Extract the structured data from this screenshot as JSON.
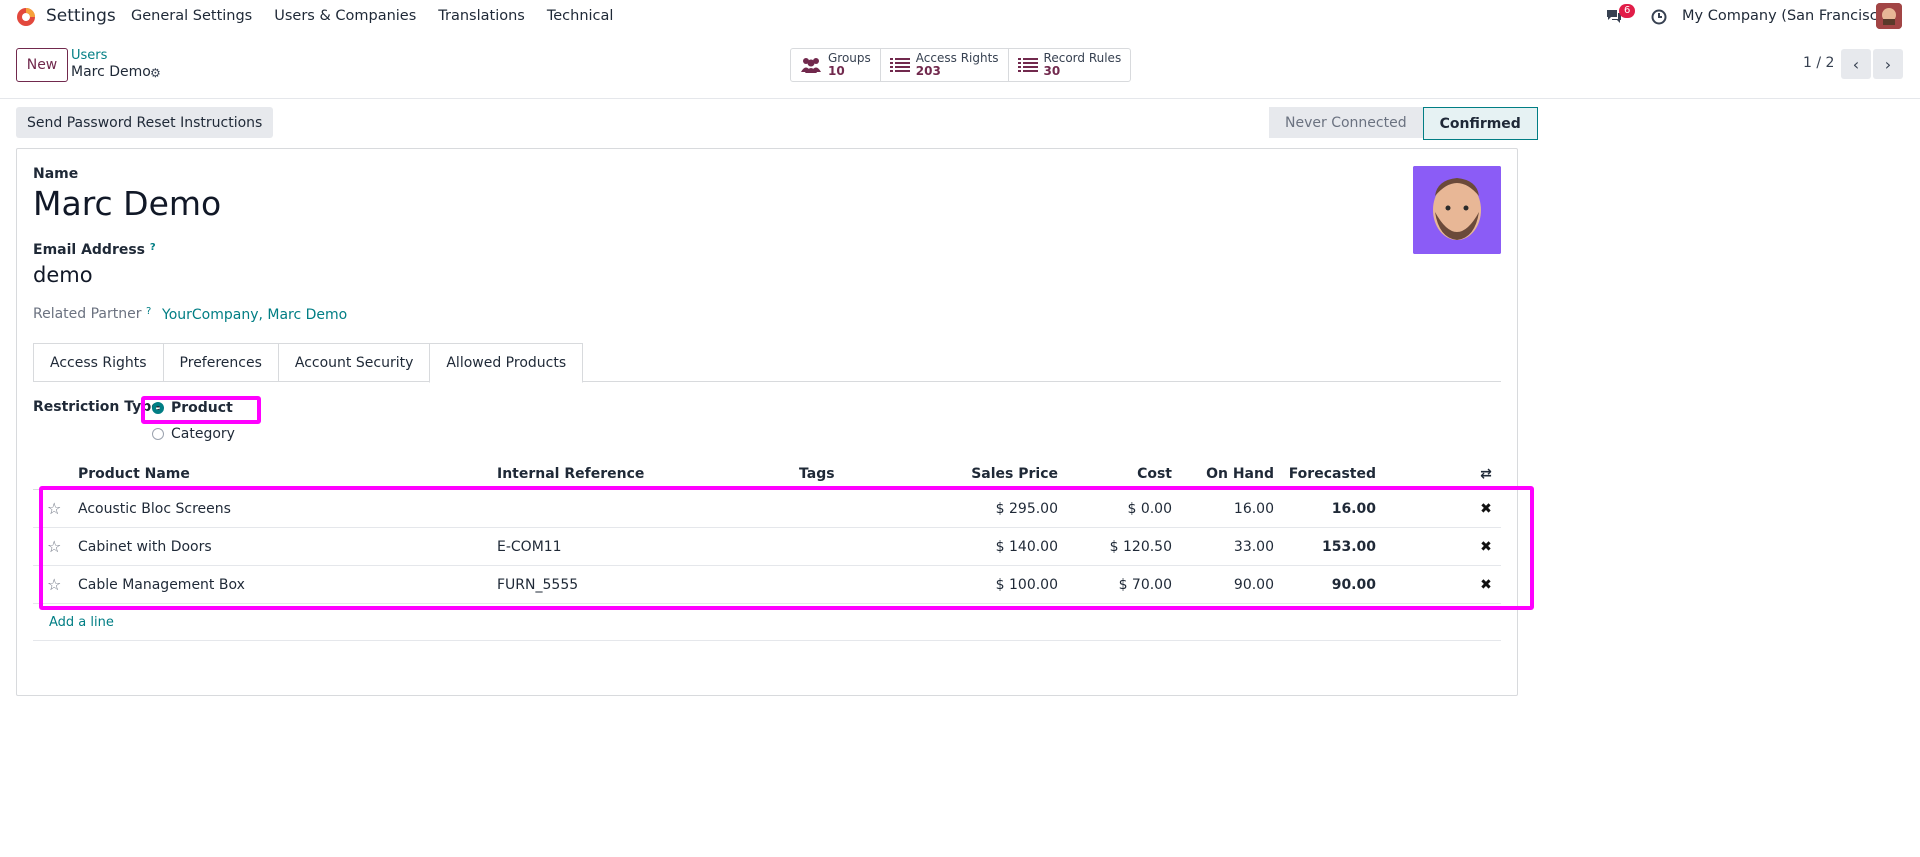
{
  "navbar": {
    "app": "Settings",
    "menu": [
      "General Settings",
      "Users & Companies",
      "Translations",
      "Technical"
    ],
    "chat_count": "6",
    "company": "My Company (San Francisco)"
  },
  "control": {
    "new_label": "New",
    "breadcrumb_parent": "Users",
    "breadcrumb_current": "Marc Demo",
    "smart_buttons": [
      {
        "label": "Groups",
        "value": "10"
      },
      {
        "label": "Access Rights",
        "value": "203"
      },
      {
        "label": "Record Rules",
        "value": "30"
      }
    ],
    "pager": "1 / 2"
  },
  "statusbar": {
    "reset_label": "Send Password Reset Instructions",
    "states": [
      "Never Connected",
      "Confirmed"
    ],
    "active_state": "Confirmed"
  },
  "form": {
    "name_label": "Name",
    "name": "Marc Demo",
    "email_label": "Email Address",
    "email_help": "?",
    "email": "demo",
    "related_label": "Related Partner",
    "related_help": "?",
    "related_value": "YourCompany, Marc Demo",
    "tabs": [
      "Access Rights",
      "Preferences",
      "Account Security",
      "Allowed Products"
    ],
    "active_tab": "Allowed Products",
    "restriction_label": "Restriction Type",
    "restriction_options": [
      "Product",
      "Category"
    ],
    "restriction_selected": "Product"
  },
  "table": {
    "headers": [
      "Product Name",
      "Internal Reference",
      "Tags",
      "Sales Price",
      "Cost",
      "On Hand",
      "Forecasted"
    ],
    "rows": [
      {
        "name": "Acoustic Bloc Screens",
        "ref": "",
        "tags": "",
        "price": "$ 295.00",
        "cost": "$ 0.00",
        "onhand": "16.00",
        "forecast": "16.00"
      },
      {
        "name": "Cabinet with Doors",
        "ref": "E-COM11",
        "tags": "",
        "price": "$ 140.00",
        "cost": "$ 120.50",
        "onhand": "33.00",
        "forecast": "153.00"
      },
      {
        "name": "Cable Management Box",
        "ref": "FURN_5555",
        "tags": "",
        "price": "$ 100.00",
        "cost": "$ 70.00",
        "onhand": "90.00",
        "forecast": "90.00"
      }
    ],
    "add_line": "Add a line"
  },
  "colors": {
    "brand": "#71294d",
    "teal": "#017e84",
    "highlight": "#ff00ff"
  }
}
